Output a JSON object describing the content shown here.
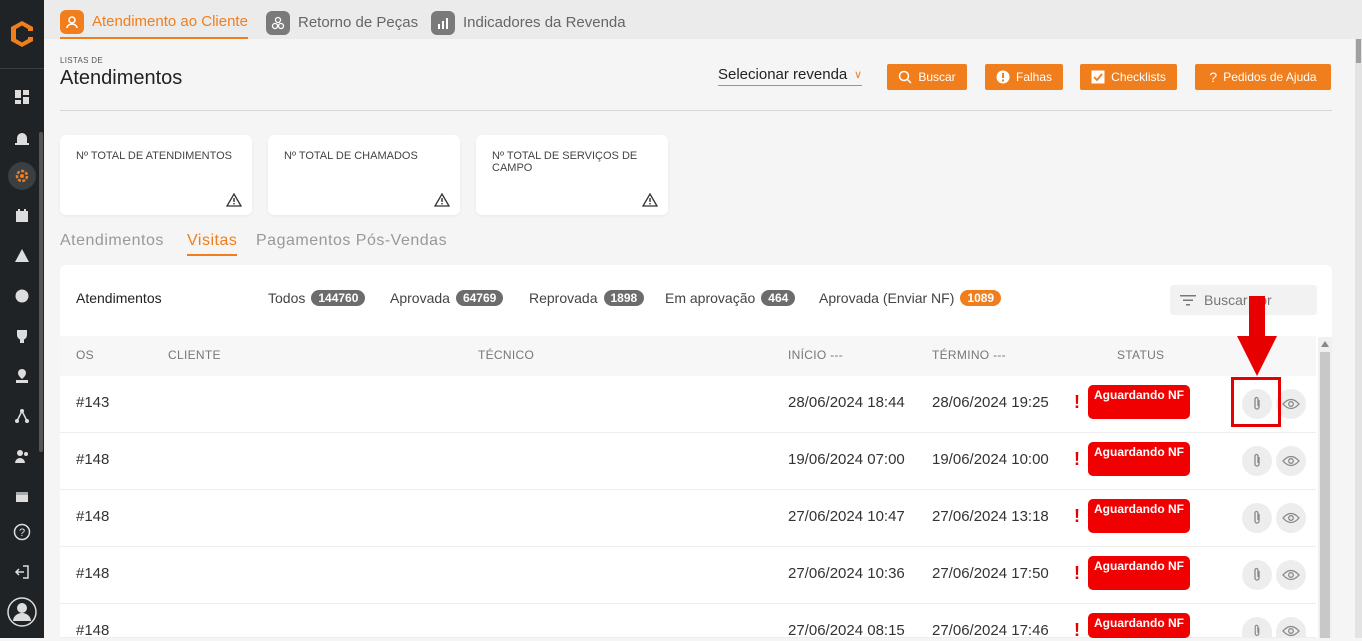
{
  "colors": {
    "accent": "#f07e1d",
    "status_red": "#f00000",
    "sidebar_bg": "#1f2326"
  },
  "sidebar": {
    "icons": [
      "dashboard-icon",
      "alarm-icon",
      "service-gear-icon",
      "calendar-icon",
      "warning-icon",
      "globe-icon",
      "trophy-icon",
      "location-icon",
      "network-icon",
      "users-icon",
      "agenda-icon",
      "help-icon",
      "logout-icon",
      "user-avatar-icon"
    ]
  },
  "top_tabs": [
    {
      "label": "Atendimento ao Cliente",
      "icon": "customer-service-icon",
      "active": true
    },
    {
      "label": "Retorno de Peças",
      "icon": "parts-icon",
      "active": false
    },
    {
      "label": "Indicadores da Revenda",
      "icon": "bar-chart-icon",
      "active": false
    }
  ],
  "header": {
    "subtitle": "LISTAS DE",
    "title": "Atendimentos",
    "revenda_select": "Selecionar revenda"
  },
  "buttons": {
    "buscar": "Buscar",
    "falhas": "Falhas",
    "checklists": "Checklists",
    "ajuda": "Pedidos de Ajuda"
  },
  "cards": [
    {
      "label": "Nº TOTAL DE ATENDIMENTOS"
    },
    {
      "label": "Nº TOTAL DE CHAMADOS"
    },
    {
      "label": "Nº TOTAL DE SERVIÇOS DE CAMPO"
    }
  ],
  "section_tabs": [
    {
      "label": "Atendimentos",
      "active": false
    },
    {
      "label": "Visitas",
      "active": true
    },
    {
      "label": "Pagamentos Pós-Vendas",
      "active": false
    }
  ],
  "panel": {
    "title": "Atendimentos",
    "filters": [
      {
        "label": "Todos",
        "count": "144760"
      },
      {
        "label": "Aprovada",
        "count": "64769"
      },
      {
        "label": "Reprovada",
        "count": "1898"
      },
      {
        "label": "Em aprovação",
        "count": "464"
      },
      {
        "label": "Aprovada (Enviar NF)",
        "count": "1089"
      }
    ],
    "search_placeholder": "Buscar por"
  },
  "table": {
    "columns": {
      "os": "OS",
      "cliente": "CLIENTE",
      "tecnico": "TÉCNICO",
      "inicio": "INÍCIO ---",
      "termino": "TÉRMINO ---",
      "status": "STATUS"
    },
    "rows": [
      {
        "os": "#143",
        "cliente": "",
        "tecnico": "",
        "inicio": "28/06/2024 18:44",
        "termino": "28/06/2024 19:25",
        "alert": "!",
        "status": "Aguardando NF"
      },
      {
        "os": "#148",
        "cliente": "",
        "tecnico": "",
        "inicio": "19/06/2024 07:00",
        "termino": "19/06/2024 10:00",
        "alert": "!",
        "status": "Aguardando NF"
      },
      {
        "os": "#148",
        "cliente": "",
        "tecnico": "",
        "inicio": "27/06/2024 10:47",
        "termino": "27/06/2024 13:18",
        "alert": "!",
        "status": "Aguardando NF"
      },
      {
        "os": "#148",
        "cliente": "",
        "tecnico": "",
        "inicio": "27/06/2024 10:36",
        "termino": "27/06/2024 17:50",
        "alert": "!",
        "status": "Aguardando NF"
      },
      {
        "os": "#148",
        "cliente": "",
        "tecnico": "",
        "inicio": "27/06/2024 08:15",
        "termino": "27/06/2024 17:46",
        "alert": "!",
        "status": "Aguardando NF"
      }
    ]
  }
}
